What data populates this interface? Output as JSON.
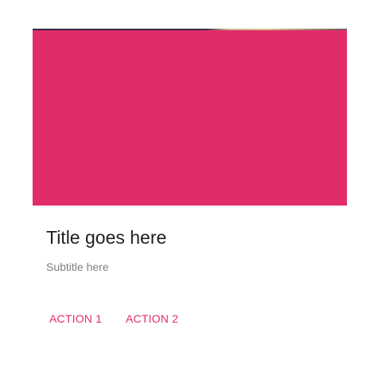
{
  "card": {
    "title": "Title goes here",
    "subtitle": "Subtitle here",
    "actions": [
      {
        "label": "ACTION 1"
      },
      {
        "label": "ACTION 2"
      }
    ],
    "colors": {
      "media": "#e22b6b",
      "accent": "#e22b6b",
      "title": "#212121",
      "subtitle": "#808080"
    }
  }
}
